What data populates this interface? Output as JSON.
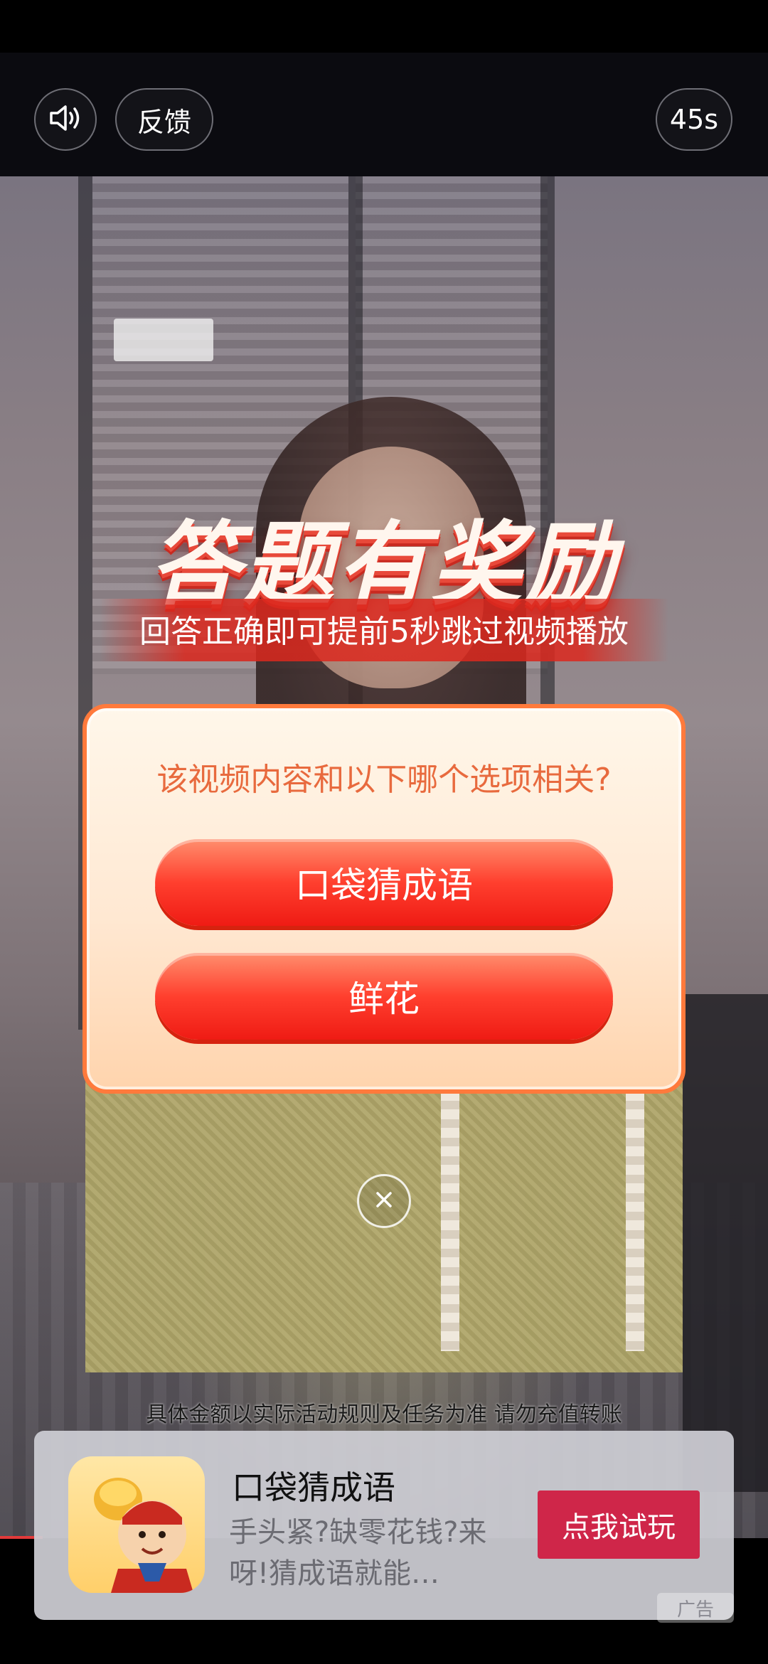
{
  "top_bar": {
    "sound_icon": "speaker-icon",
    "feedback_label": "反馈",
    "countdown": "45s"
  },
  "quiz": {
    "title": "答题有奖励",
    "subtitle": "回答正确即可提前5秒跳过视频播放",
    "question": "该视频内容和以下哪个选项相关?",
    "options": [
      {
        "label": "口袋猜成语"
      },
      {
        "label": "鲜花"
      }
    ],
    "close_icon": "close-icon"
  },
  "disclaimer": "具体金额以实际活动规则及任务为准 请勿充值转账",
  "ad": {
    "app_name": "口袋猜成语",
    "description": "手头紧?缺零花钱?来呀!猜成语就能…",
    "cta_label": "点我试玩",
    "badge": "广告"
  },
  "colors": {
    "accent_red": "#ff3f2e",
    "card_border": "#ff7a3c",
    "cta_bg": "#cf2649",
    "question_text": "#e86a3e"
  }
}
